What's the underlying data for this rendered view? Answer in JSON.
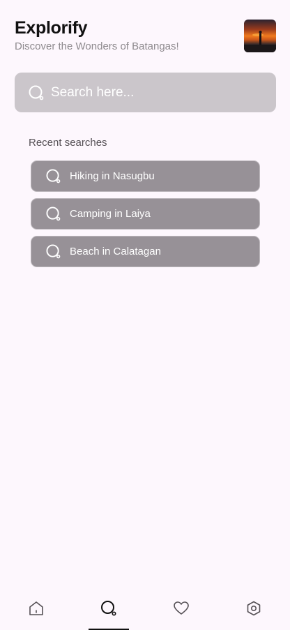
{
  "header": {
    "title": "Explorify",
    "subtitle": "Discover the Wonders of Batangas!"
  },
  "search": {
    "placeholder": "Search here..."
  },
  "recent": {
    "label": "Recent searches",
    "items": [
      {
        "label": "Hiking in Nasugbu"
      },
      {
        "label": "Camping in Laiya"
      },
      {
        "label": "Beach in Calatagan"
      }
    ]
  },
  "nav": {
    "items": [
      {
        "icon": "home-icon"
      },
      {
        "icon": "search-icon",
        "active": true
      },
      {
        "icon": "heart-icon"
      },
      {
        "icon": "settings-icon"
      }
    ]
  },
  "colors": {
    "background": "#fdf7fd",
    "search_bar": "#cbc6cb",
    "recent_item": "#979197",
    "nav_icon": "#555055"
  }
}
